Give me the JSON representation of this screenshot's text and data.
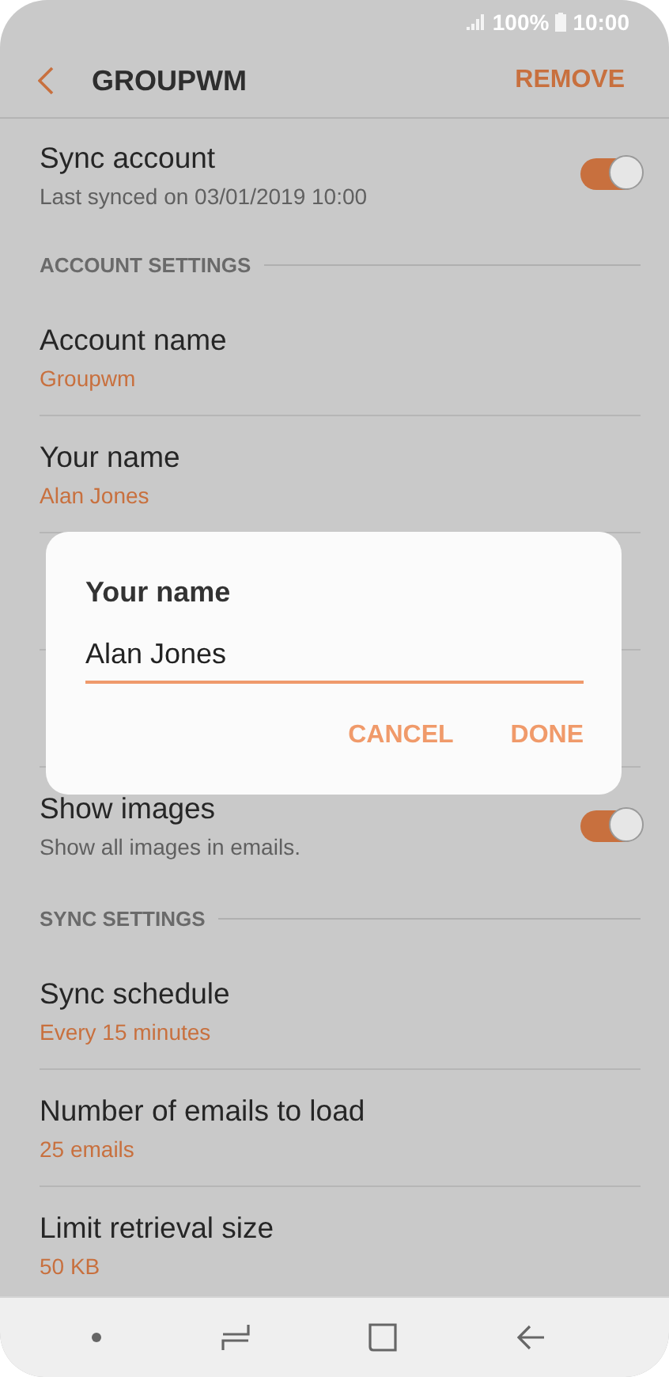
{
  "status_bar": {
    "battery": "100%",
    "time": "10:00"
  },
  "header": {
    "title": "GROUPWM",
    "action": "REMOVE"
  },
  "items": [
    {
      "kind": "toggle",
      "title": "Sync account",
      "subtitle": "Last synced on 03/01/2019  10:00",
      "on": true
    },
    {
      "kind": "section",
      "title": "ACCOUNT SETTINGS"
    },
    {
      "kind": "value",
      "title": "Account name",
      "subtitle": "Groupwm"
    },
    {
      "kind": "value",
      "title": "Your name",
      "subtitle": "Alan Jones"
    },
    {
      "kind": "covered"
    },
    {
      "kind": "covered"
    },
    {
      "kind": "toggle",
      "title": "Show images",
      "subtitle": "Show all images in emails.",
      "on": true
    },
    {
      "kind": "section",
      "title": "SYNC SETTINGS"
    },
    {
      "kind": "value",
      "title": "Sync schedule",
      "subtitle": "Every 15 minutes"
    },
    {
      "kind": "value",
      "title": "Number of emails to load",
      "subtitle": "25 emails"
    },
    {
      "kind": "value",
      "title": "Limit retrieval size",
      "subtitle": "50 KB"
    }
  ],
  "dialog": {
    "title": "Your name",
    "value": "Alan Jones",
    "buttons": [
      "CANCEL",
      "DONE"
    ]
  }
}
